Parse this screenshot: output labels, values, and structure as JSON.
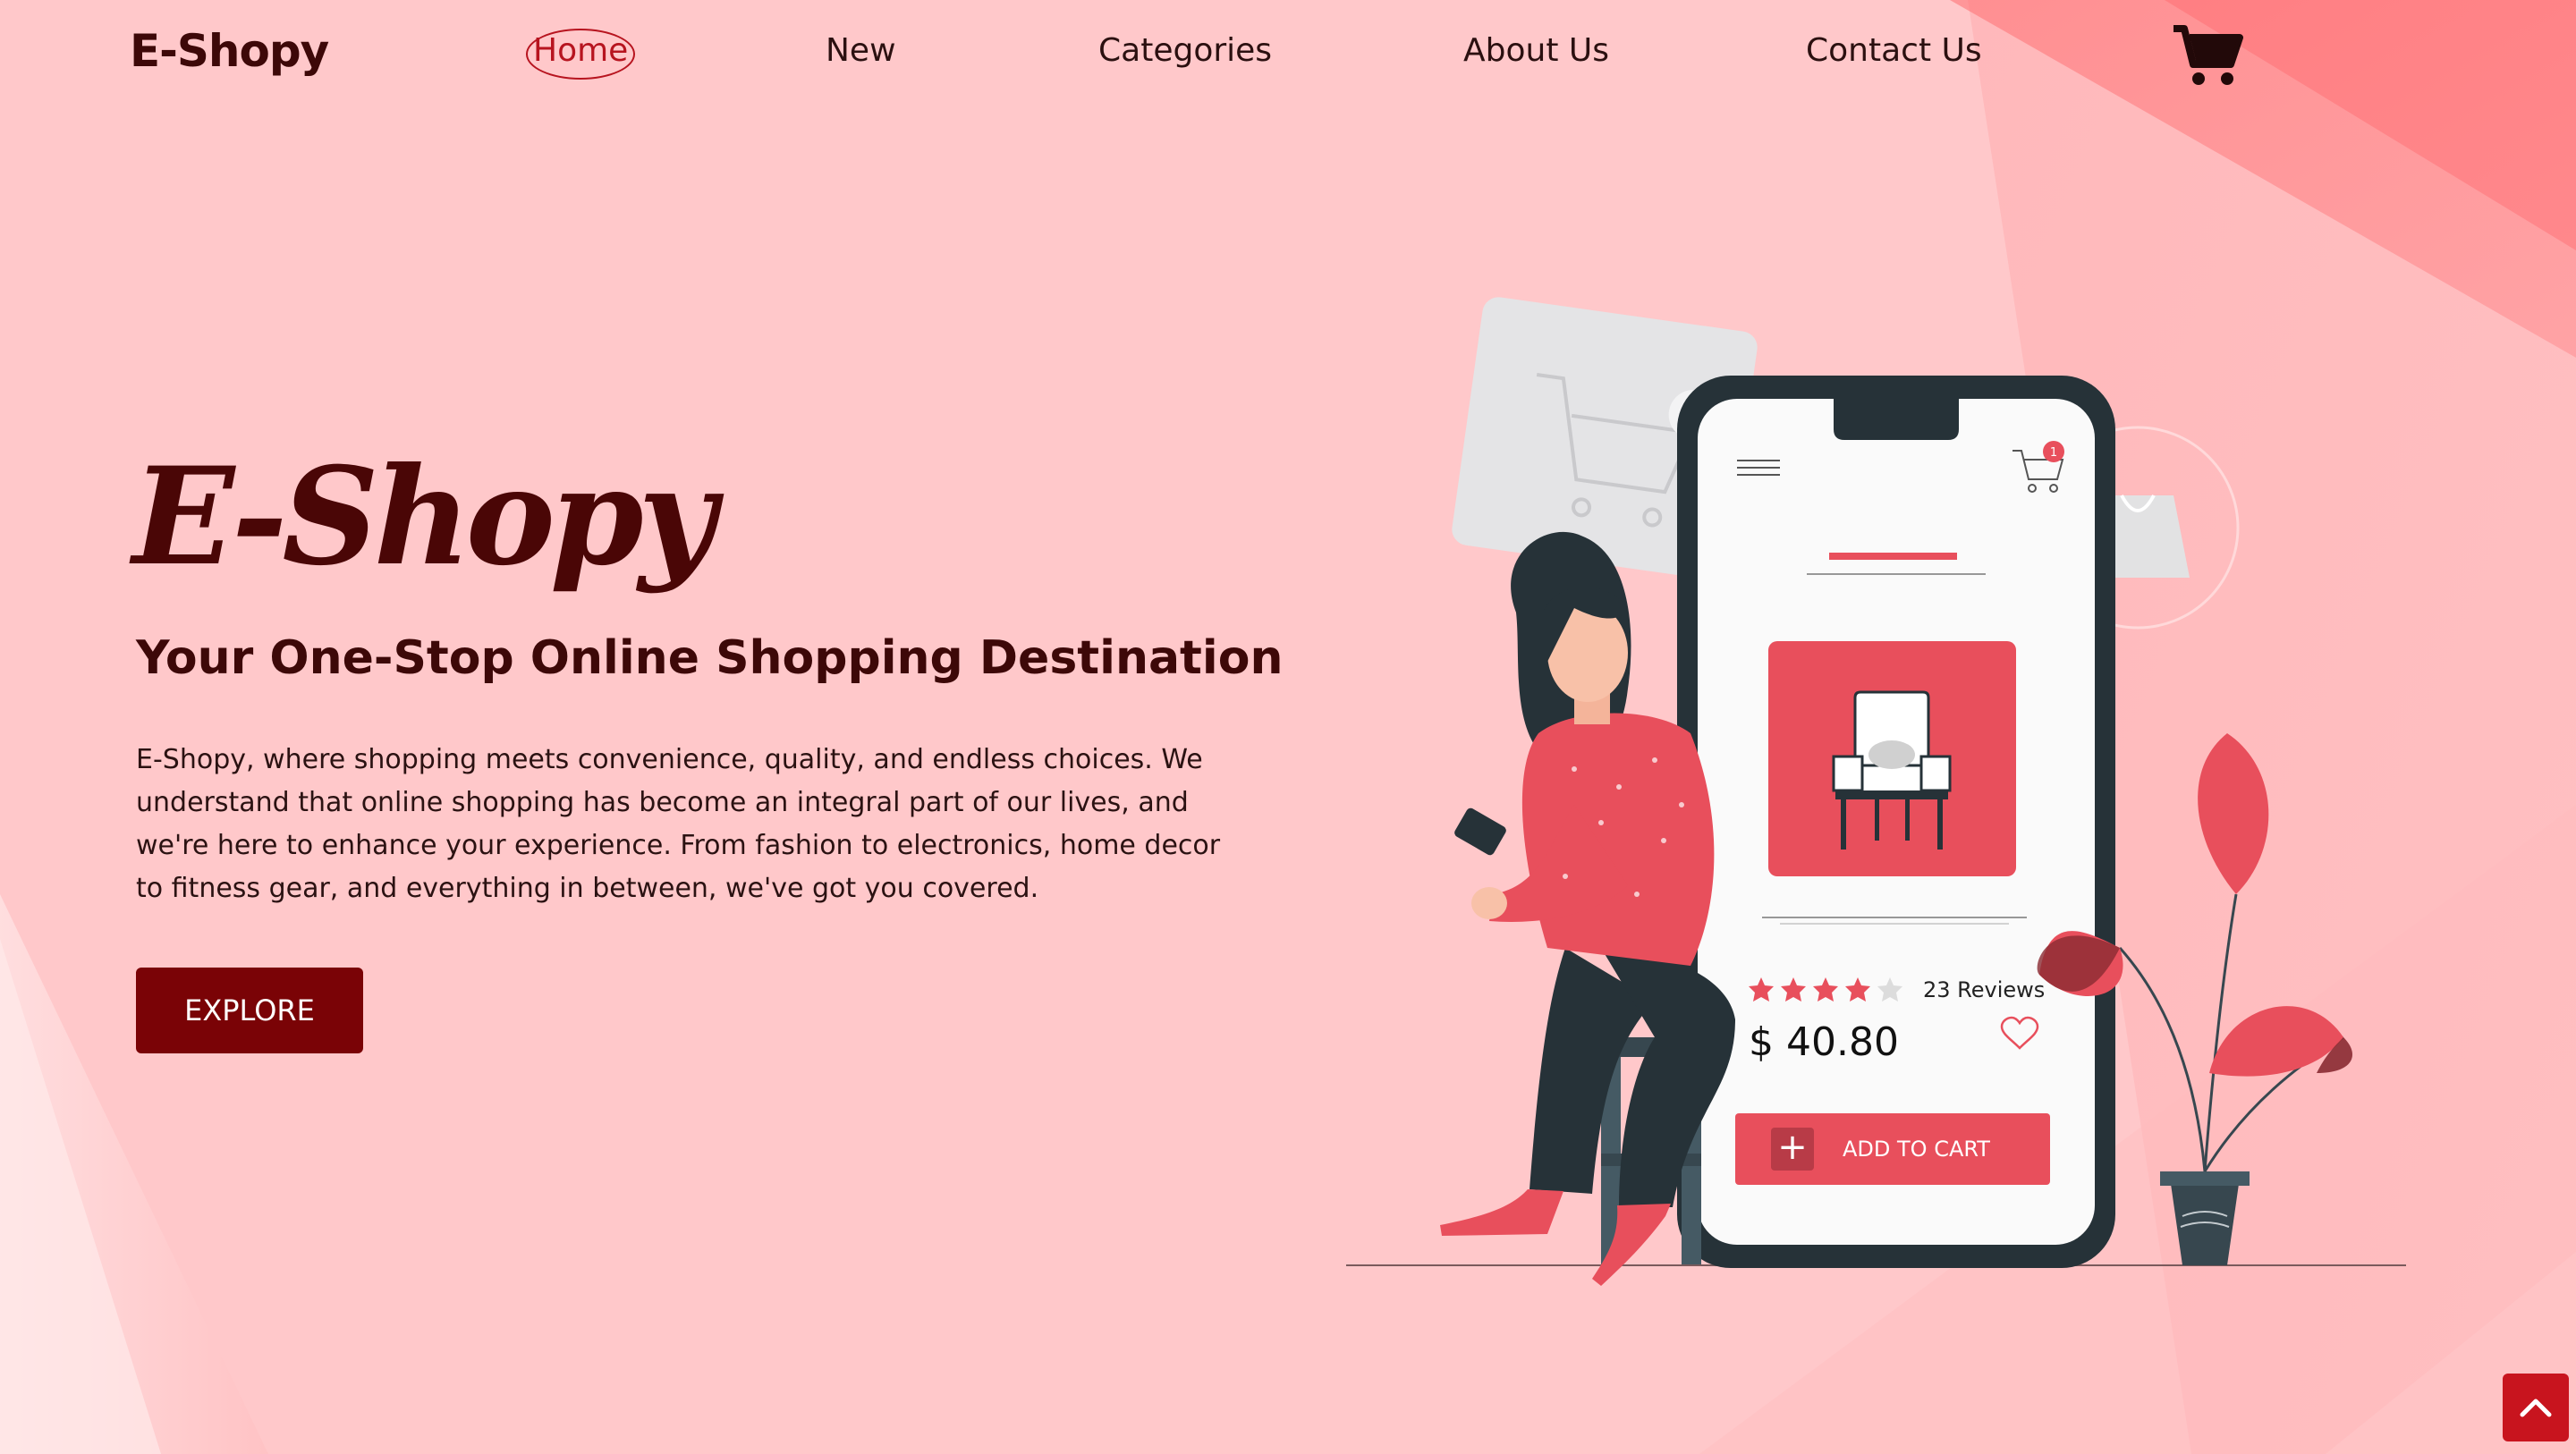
{
  "brand": "E-Shopy",
  "nav": {
    "items": [
      {
        "label": "Home",
        "active": true
      },
      {
        "label": "New"
      },
      {
        "label": "Categories"
      },
      {
        "label": "About Us"
      },
      {
        "label": "Contact Us"
      }
    ],
    "cart_icon": "shopping-cart-icon"
  },
  "hero": {
    "title": "E-Shopy",
    "subtitle": "Your One-Stop Online Shopping Destination",
    "description": "E-Shopy, where shopping meets convenience, quality, and endless choices. We understand that online shopping has become an integral part of our lives, and we're here to enhance your experience. From fashion to electronics, home decor to fitness gear, and everything in between, we've got you covered.",
    "explore_label": "EXPLORE"
  },
  "phone": {
    "cart_badge": "1",
    "rating": 4,
    "rating_max": 5,
    "reviews": "23 Reviews",
    "price": "$ 40.80",
    "add_to_cart": "ADD TO CART"
  },
  "colors": {
    "background": "#ffc8ca",
    "accent": "#7a0306",
    "brand_red": "#e84f5c",
    "active_nav": "#b7141f"
  },
  "icons": {
    "scroll_top": "chevron-up-icon"
  }
}
